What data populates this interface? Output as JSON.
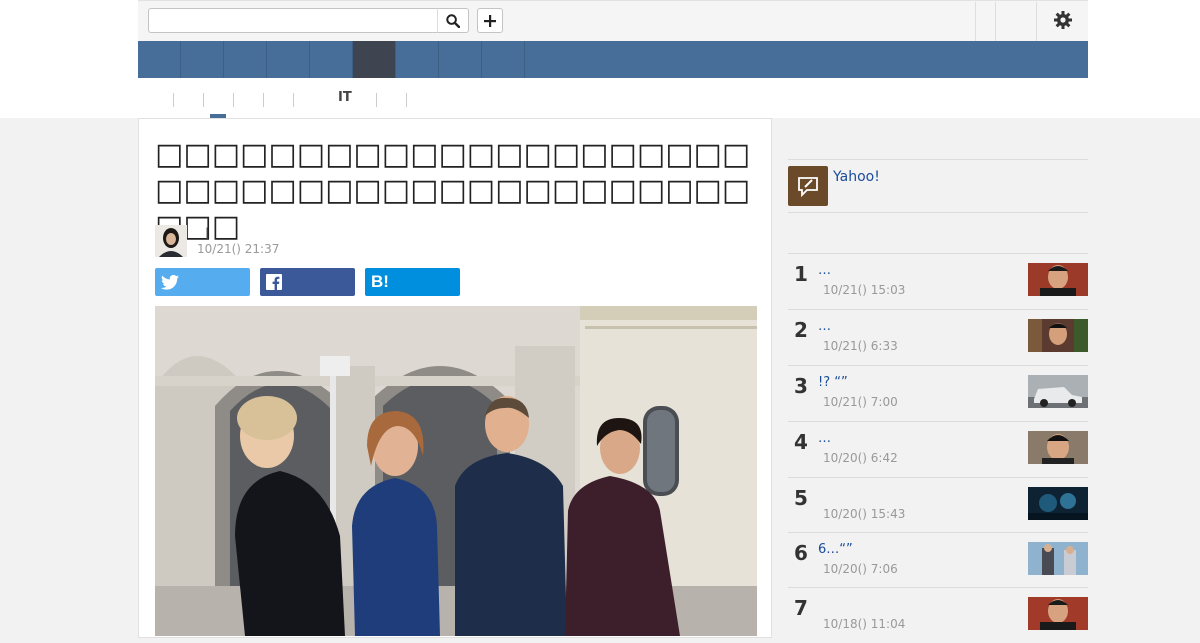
{
  "header": {
    "search_placeholder": "",
    "search_icon": "search-icon",
    "add_icon": "plus-icon",
    "settings_icon": "gear-icon"
  },
  "nav": {
    "items": [
      "",
      "",
      "",
      "",
      "",
      "",
      "",
      "",
      ""
    ],
    "active_index": 5,
    "color": "#476e98",
    "active_color": "#3f4550"
  },
  "subtabs": {
    "items": [
      "",
      "",
      "",
      "",
      "",
      "IT",
      ""
    ],
    "active_index": 1
  },
  "article": {
    "title": "□□□□□□□□□□□□□□□□□□□□□□□□□□□□□□□□□□□□□□□□□□□□□",
    "author_separator": "|",
    "date": "10/21() 21:37",
    "share": {
      "twitter_icon": "twitter-icon",
      "facebook_icon": "facebook-icon",
      "hatena_label": "B!"
    },
    "photo": "photo-of-four-people-in-front-of-building"
  },
  "sidebar": {
    "yahoo_label": "Yahoo!",
    "ranking": [
      {
        "rank": "1",
        "title": "…",
        "date": "10/21() 15:03"
      },
      {
        "rank": "2",
        "title": "…",
        "date": "10/21() 6:33"
      },
      {
        "rank": "3",
        "title": "!? “”",
        "date": "10/21() 7:00"
      },
      {
        "rank": "4",
        "title": "…",
        "date": "10/20() 6:42"
      },
      {
        "rank": "5",
        "title": "",
        "date": "10/20() 15:43"
      },
      {
        "rank": "6",
        "title": "6…“”",
        "date": "10/20() 7:06"
      },
      {
        "rank": "7",
        "title": "",
        "date": "10/18() 11:04"
      }
    ]
  }
}
